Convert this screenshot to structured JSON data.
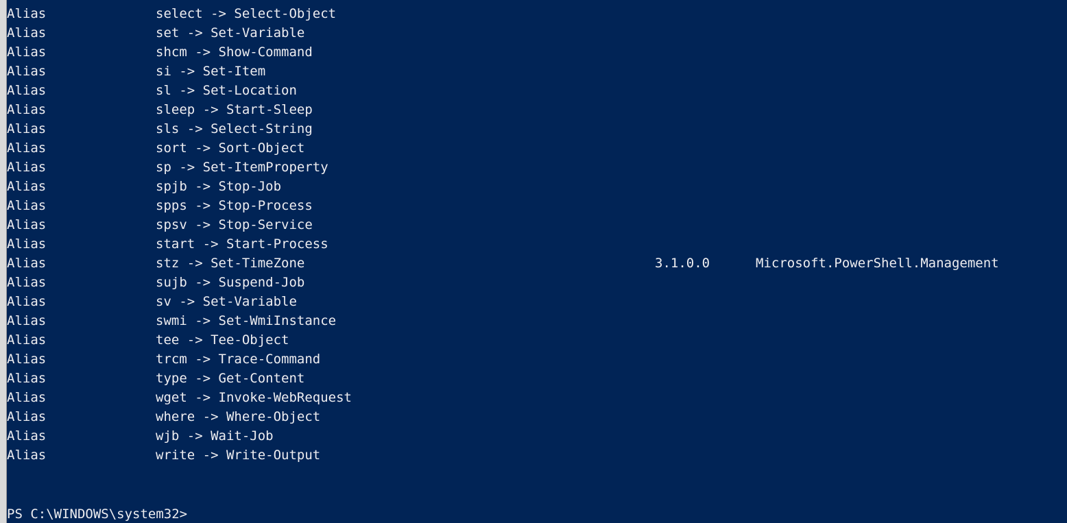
{
  "console": {
    "background_color": "#012456",
    "text_color": "#eeedf0",
    "rows": [
      {
        "type": "Alias",
        "name": "select -> Select-Object",
        "version": "",
        "source": ""
      },
      {
        "type": "Alias",
        "name": "set -> Set-Variable",
        "version": "",
        "source": ""
      },
      {
        "type": "Alias",
        "name": "shcm -> Show-Command",
        "version": "",
        "source": ""
      },
      {
        "type": "Alias",
        "name": "si -> Set-Item",
        "version": "",
        "source": ""
      },
      {
        "type": "Alias",
        "name": "sl -> Set-Location",
        "version": "",
        "source": ""
      },
      {
        "type": "Alias",
        "name": "sleep -> Start-Sleep",
        "version": "",
        "source": ""
      },
      {
        "type": "Alias",
        "name": "sls -> Select-String",
        "version": "",
        "source": ""
      },
      {
        "type": "Alias",
        "name": "sort -> Sort-Object",
        "version": "",
        "source": ""
      },
      {
        "type": "Alias",
        "name": "sp -> Set-ItemProperty",
        "version": "",
        "source": ""
      },
      {
        "type": "Alias",
        "name": "spjb -> Stop-Job",
        "version": "",
        "source": ""
      },
      {
        "type": "Alias",
        "name": "spps -> Stop-Process",
        "version": "",
        "source": ""
      },
      {
        "type": "Alias",
        "name": "spsv -> Stop-Service",
        "version": "",
        "source": ""
      },
      {
        "type": "Alias",
        "name": "start -> Start-Process",
        "version": "",
        "source": ""
      },
      {
        "type": "Alias",
        "name": "stz -> Set-TimeZone",
        "version": "3.1.0.0",
        "source": "Microsoft.PowerShell.Management"
      },
      {
        "type": "Alias",
        "name": "sujb -> Suspend-Job",
        "version": "",
        "source": ""
      },
      {
        "type": "Alias",
        "name": "sv -> Set-Variable",
        "version": "",
        "source": ""
      },
      {
        "type": "Alias",
        "name": "swmi -> Set-WmiInstance",
        "version": "",
        "source": ""
      },
      {
        "type": "Alias",
        "name": "tee -> Tee-Object",
        "version": "",
        "source": ""
      },
      {
        "type": "Alias",
        "name": "trcm -> Trace-Command",
        "version": "",
        "source": ""
      },
      {
        "type": "Alias",
        "name": "type -> Get-Content",
        "version": "",
        "source": ""
      },
      {
        "type": "Alias",
        "name": "wget -> Invoke-WebRequest",
        "version": "",
        "source": ""
      },
      {
        "type": "Alias",
        "name": "where -> Where-Object",
        "version": "",
        "source": ""
      },
      {
        "type": "Alias",
        "name": "wjb -> Wait-Job",
        "version": "",
        "source": ""
      },
      {
        "type": "Alias",
        "name": "write -> Write-Output",
        "version": "",
        "source": ""
      }
    ],
    "prompt": "PS C:\\WINDOWS\\system32>"
  }
}
